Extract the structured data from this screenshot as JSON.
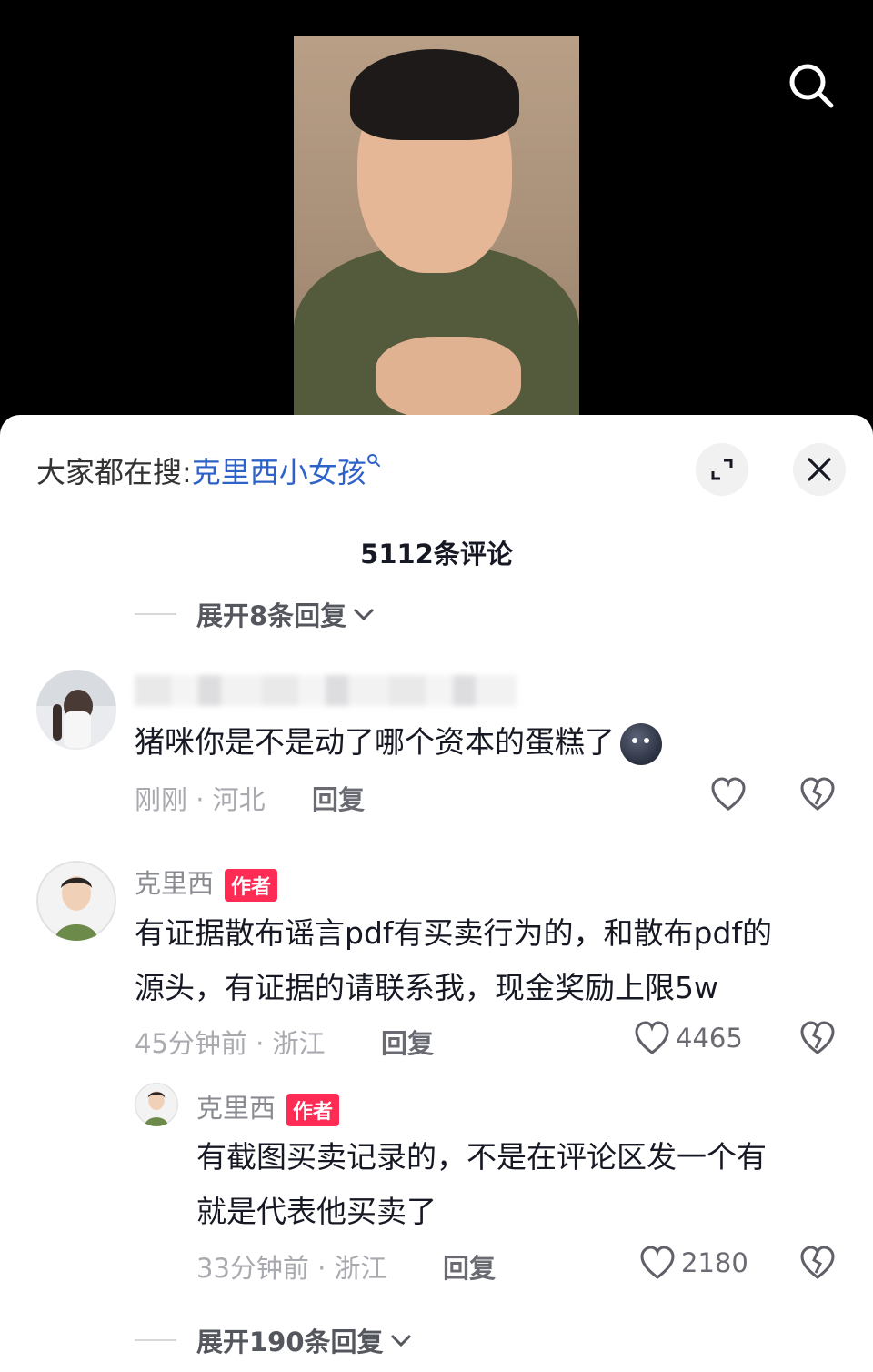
{
  "hot_search": {
    "prefix": "大家都在搜:",
    "term": "克里西小女孩"
  },
  "comment_count": "5112条评论",
  "expand_top": "展开8条回复",
  "comments": [
    {
      "name": "",
      "text": "猪咪你是不是动了哪个资本的蛋糕了",
      "emoji": "moon-face-emoji",
      "meta": "刚刚 · 河北",
      "reply": "回复",
      "likes": ""
    },
    {
      "name": "克里西",
      "badge": "作者",
      "text_line1": "有证据散布谣言pdf有买卖行为的，和散布pdf的",
      "text_line2": "源头，有证据的请联系我，现金奖励上限5w",
      "meta": "45分钟前 · 浙江",
      "reply": "回复",
      "likes": "4465"
    },
    {
      "name": "克里西",
      "badge": "作者",
      "text_line1": "有截图买卖记录的，不是在评论区发一个有",
      "text_line2": "就是代表他买卖了",
      "meta": "33分钟前 · 浙江",
      "reply": "回复",
      "likes": "2180"
    }
  ],
  "expand_bottom": "展开190条回复",
  "colors": {
    "accent_red": "#fe2c55",
    "link_blue": "#2d63c8"
  }
}
